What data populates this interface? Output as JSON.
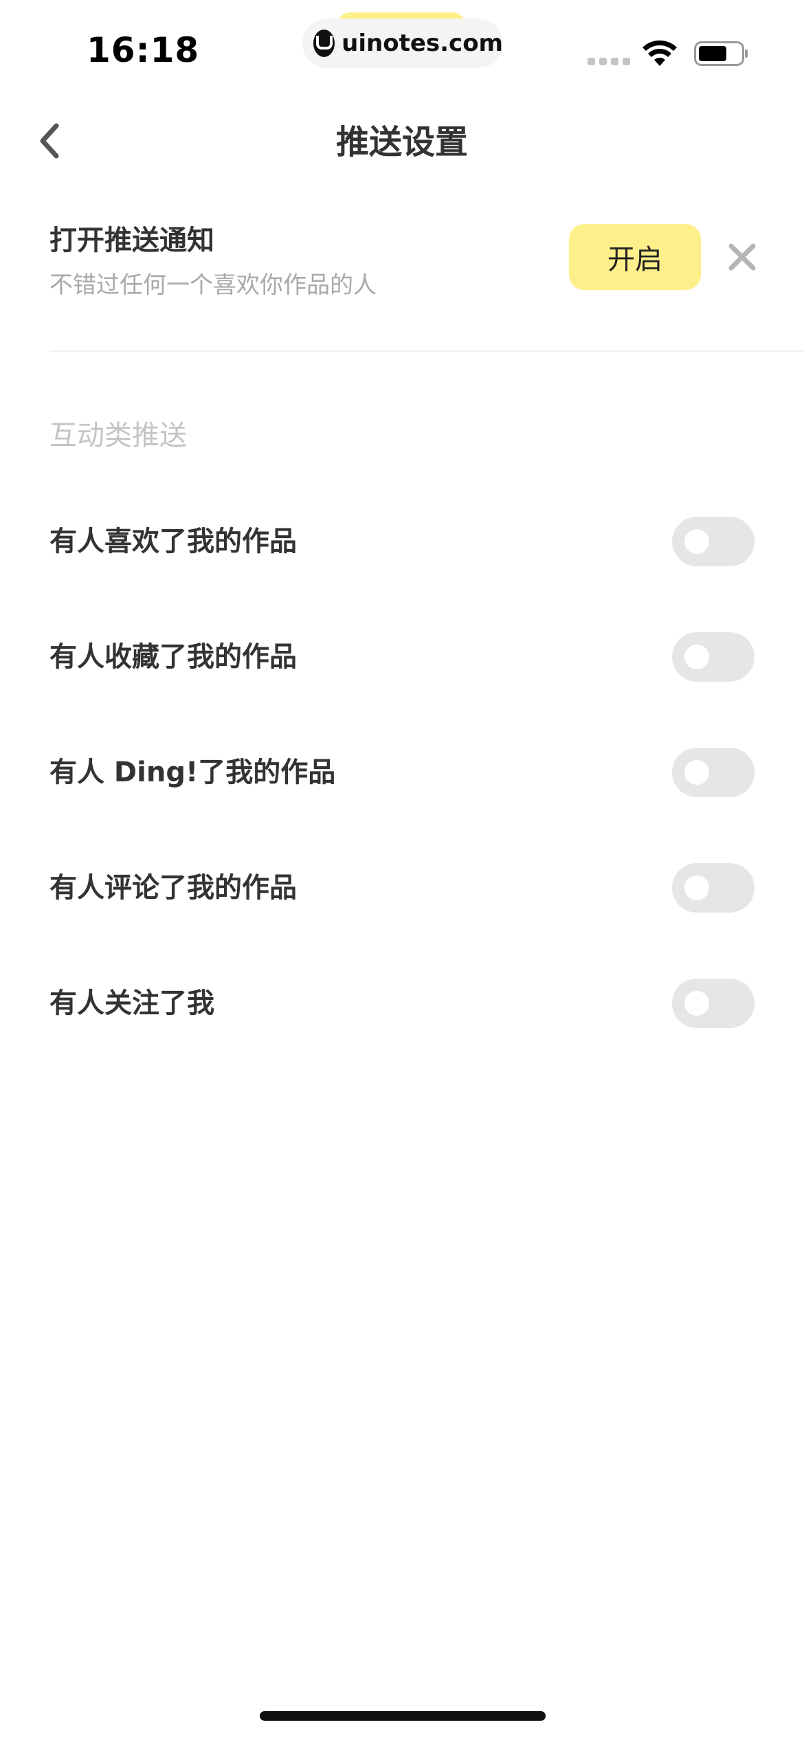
{
  "status_bar": {
    "time": "16:18",
    "url": "uinotes.com"
  },
  "nav": {
    "title": "推送设置"
  },
  "banner": {
    "title": "打开推送通知",
    "subtitle": "不错过任何一个喜欢你作品的人",
    "enable_label": "开启"
  },
  "section": {
    "header": "互动类推送",
    "items": [
      {
        "label": "有人喜欢了我的作品",
        "enabled": false
      },
      {
        "label": "有人收藏了我的作品",
        "enabled": false
      },
      {
        "label": "有人 Ding!了我的作品",
        "enabled": false
      },
      {
        "label": "有人评论了我的作品",
        "enabled": false
      },
      {
        "label": "有人关注了我",
        "enabled": false
      }
    ]
  },
  "colors": {
    "accent_yellow": "#fdf08a",
    "toggle_off": "#e6e6e6",
    "text_primary": "#333333",
    "text_secondary": "#a9a9a9",
    "section_header": "#c4c4c4"
  },
  "icons": {
    "back": "chevron-left-icon",
    "close": "close-icon",
    "wifi": "wifi-icon",
    "battery": "battery-icon"
  }
}
